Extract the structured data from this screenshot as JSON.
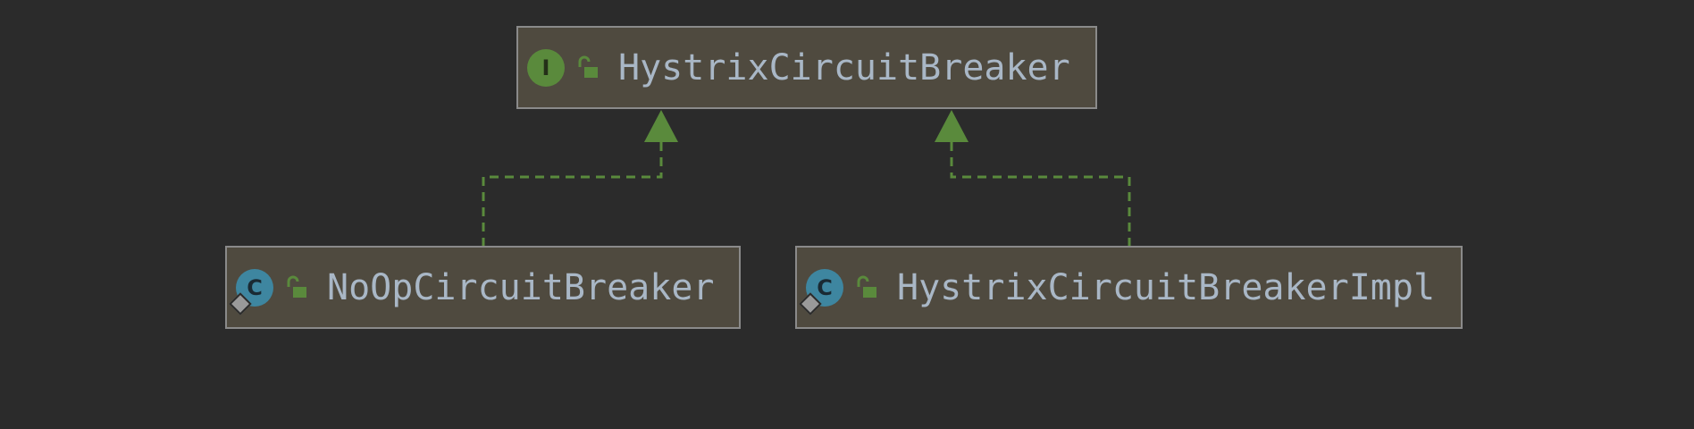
{
  "diagram": {
    "colors": {
      "background": "#2b2b2b",
      "node_fill": "#4f4a3f",
      "node_border": "#8a8a8a",
      "label": "#a9b7c6",
      "edge": "#5a8a3c",
      "interface_icon": "#5a8a3c",
      "class_icon": "#3e86a0"
    },
    "nodes": [
      {
        "id": "hystrix-circuit-breaker",
        "label": "HystrixCircuitBreaker",
        "kind": "interface",
        "kind_letter": "I",
        "visibility_icon": "unlocked-public-icon"
      },
      {
        "id": "noop-circuit-breaker",
        "label": "NoOpCircuitBreaker",
        "kind": "class",
        "kind_letter": "C",
        "visibility_icon": "unlocked-public-icon",
        "static_badge": true
      },
      {
        "id": "hystrix-circuit-breaker-impl",
        "label": "HystrixCircuitBreakerImpl",
        "kind": "class",
        "kind_letter": "C",
        "visibility_icon": "unlocked-public-icon",
        "static_badge": true
      }
    ],
    "edges": [
      {
        "from": "noop-circuit-breaker",
        "to": "hystrix-circuit-breaker",
        "type": "implements"
      },
      {
        "from": "hystrix-circuit-breaker-impl",
        "to": "hystrix-circuit-breaker",
        "type": "implements"
      }
    ]
  }
}
